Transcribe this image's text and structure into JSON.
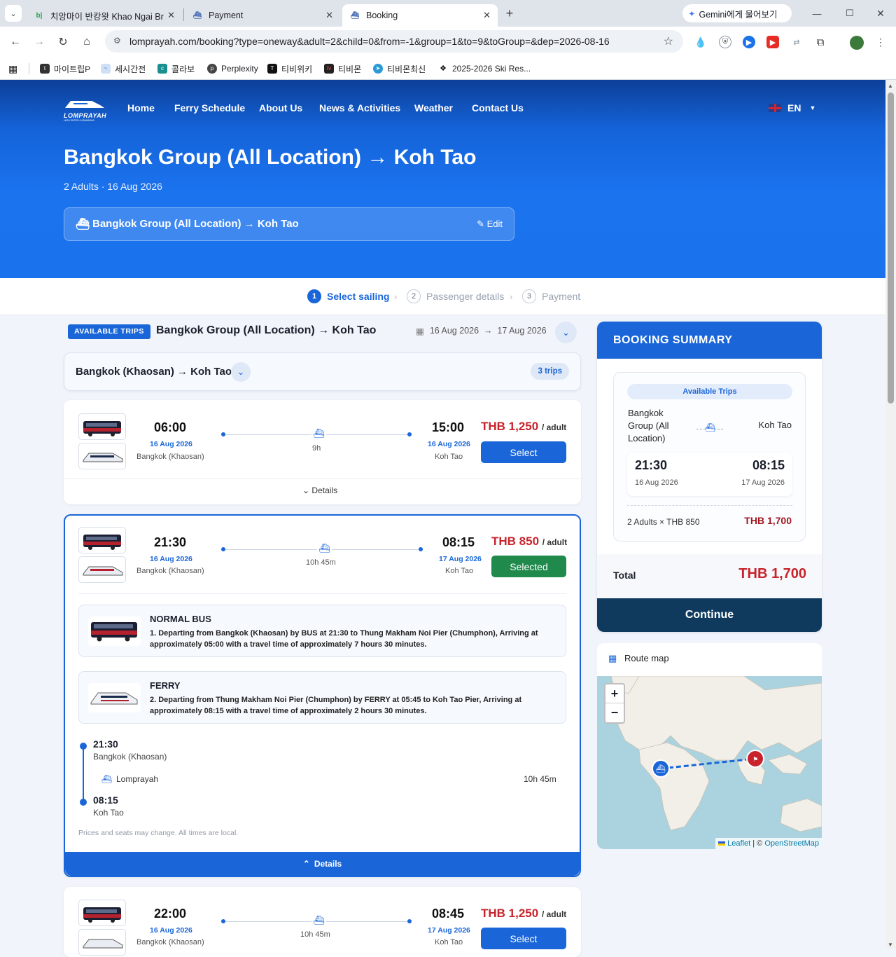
{
  "browser": {
    "tabs": [
      {
        "title": "치앙마이 반캉왓 Khao Ngai Br"
      },
      {
        "title": "Payment"
      },
      {
        "title": "Booking"
      }
    ],
    "gemini_label": "Gemini에게 물어보기",
    "url": "lomprayah.com/booking?type=oneway&adult=2&child=0&from=-1&group=1&to=9&toGroup=&dep=2026-08-16",
    "bookmarks": [
      "마이트립P",
      "세시간전",
      "콜라보",
      "Perplexity",
      "티비위키",
      "티비몬",
      "티비몬최신",
      "2025-2026 Ski Res..."
    ]
  },
  "header": {
    "logo_text": "LOMPRAYAH",
    "logo_sub": "HIGH SPEED CATAMARAN",
    "nav": [
      "Home",
      "Ferry Schedule",
      "About Us",
      "News & Activities",
      "Weather",
      "Contact Us"
    ],
    "lang": "EN"
  },
  "hero": {
    "title": "Bangkok Group (All Location) → Koh Tao",
    "subtitle": "2 Adults · 16 Aug 2026",
    "route": "Bangkok Group (All Location) → Koh Tao",
    "edit": "Edit"
  },
  "steps": [
    {
      "n": "1",
      "label": "Select sailing"
    },
    {
      "n": "2",
      "label": "Passenger details"
    },
    {
      "n": "3",
      "label": "Payment"
    }
  ],
  "list": {
    "badge": "AVAILABLE TRIPS",
    "title": "Bangkok Group (All Location) → Koh Tao",
    "dates": "16 Aug 2026  →  17 Aug 2026",
    "group_title": "Bangkok (Khaosan) → Koh Tao",
    "group_count": "3 trips",
    "details": "Details",
    "unit": "/ adult"
  },
  "trips": [
    {
      "dep_time": "06:00",
      "dep_date": "16 Aug 2026",
      "dep_place": "Bangkok (Khaosan)",
      "duration": "9h",
      "arr_time": "15:00",
      "arr_date": "16 Aug 2026",
      "arr_place": "Koh Tao",
      "price": "THB 1,250",
      "button": "Select"
    },
    {
      "dep_time": "21:30",
      "dep_date": "16 Aug 2026",
      "dep_place": "Bangkok (Khaosan)",
      "duration": "10h 45m",
      "arr_time": "08:15",
      "arr_date": "17 Aug 2026",
      "arr_place": "Koh Tao",
      "price": "THB 850",
      "button": "Selected"
    },
    {
      "dep_time": "22:00",
      "dep_date": "16 Aug 2026",
      "dep_place": "Bangkok (Khaosan)",
      "duration": "10h 45m",
      "arr_time": "08:45",
      "arr_date": "17 Aug 2026",
      "arr_place": "Koh Tao",
      "price": "THB 1,250",
      "button": "Select"
    }
  ],
  "segments": [
    {
      "title": "NORMAL BUS",
      "text": "1. Departing from Bangkok (Khaosan) by BUS at 21:30 to Thung Makham Noi Pier (Chumphon), Arriving at approximately 05:00 with a travel time of approximately 7 hours 30 minutes."
    },
    {
      "title": "FERRY",
      "text": "2. Departing from Thung Makham Noi Pier (Chumphon) by FERRY at 05:45 to Koh Tao Pier, Arriving at approximately 08:15 with a travel time of approximately 2 hours 30 minutes."
    }
  ],
  "timeline": {
    "start_time": "21:30",
    "start_place": "Bangkok (Khaosan)",
    "operator": "Lomprayah",
    "duration": "10h 45m",
    "end_time": "08:15",
    "end_place": "Koh Tao",
    "note": "Prices and seats may change. All times are local."
  },
  "summary": {
    "title": "BOOKING SUMMARY",
    "chip": "Available Trips",
    "from": "Bangkok Group (All Location)",
    "to": "Koh Tao",
    "dep_time": "21:30",
    "dep_date": "16 Aug 2026",
    "arr_time": "08:15",
    "arr_date": "17 Aug 2026",
    "pax_line": "2 Adults × THB 850",
    "pax_total": "THB 1,700",
    "total_label": "Total",
    "total_value": "THB 1,700",
    "continue": "Continue"
  },
  "map": {
    "title": "Route map",
    "zoom_in": "+",
    "zoom_out": "−",
    "attribution_leaflet": "Leaflet",
    "attribution_osm": "OpenStreetMap"
  },
  "colors": {
    "primary": "#1a66d9",
    "price": "#c8232c",
    "selected": "#1f8a4c",
    "summary_dark": "#0f3a5e"
  }
}
